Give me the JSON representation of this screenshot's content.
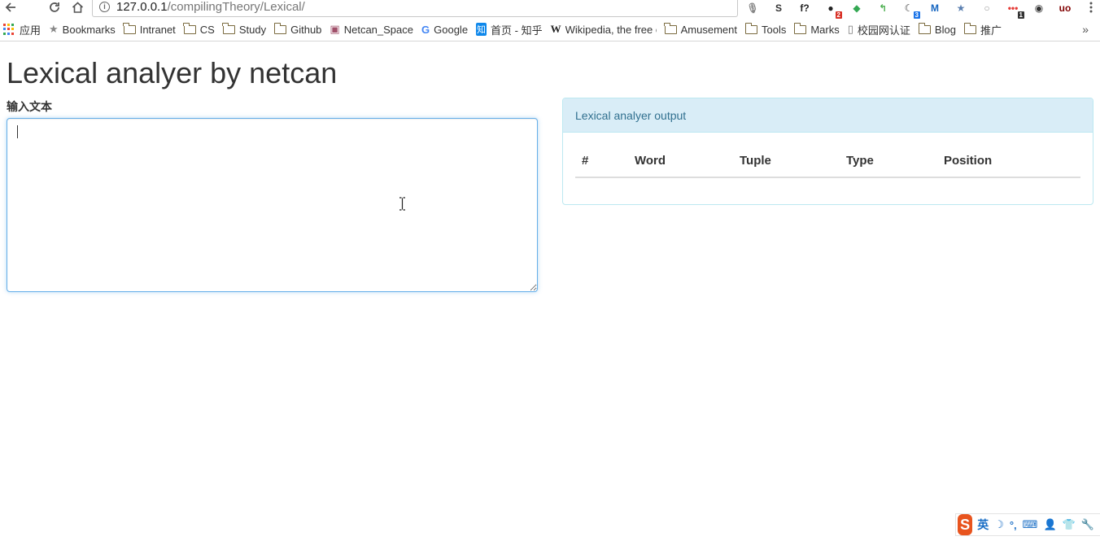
{
  "browser": {
    "url_host": "127.0.0.1",
    "url_path": "/compilingTheory/Lexical/",
    "extensions": [
      {
        "name": "mic-icon",
        "glyph": "🎙",
        "color": "#888888"
      },
      {
        "name": "s-extension-icon",
        "glyph": "S",
        "color": "#333333"
      },
      {
        "name": "f-extension-icon",
        "glyph": "f?",
        "color": "#222222"
      },
      {
        "name": "chat-extension-icon",
        "glyph": "●",
        "color": "#222222",
        "badge": "2",
        "badge_color": "#d93025"
      },
      {
        "name": "colorful-extension-icon",
        "glyph": "◆",
        "color": "#34a853"
      },
      {
        "name": "arrow-extension-icon",
        "glyph": "↰",
        "color": "#4caf50"
      },
      {
        "name": "moon-extension-icon",
        "glyph": "☾",
        "color": "#444444",
        "badge": "3",
        "badge_color": "#1a73e8"
      },
      {
        "name": "m-extension-icon",
        "glyph": "M",
        "color": "#1565c0"
      },
      {
        "name": "star-extension-icon",
        "glyph": "★",
        "color": "#5a7fb0"
      },
      {
        "name": "circle-extension-icon",
        "glyph": "○",
        "color": "#999999"
      },
      {
        "name": "dots-extension-icon",
        "glyph": "•••",
        "color": "#e53935",
        "badge": "1",
        "badge_color": "#333333"
      },
      {
        "name": "camera-extension-icon",
        "glyph": "◉",
        "color": "#333333"
      },
      {
        "name": "ublock-icon",
        "glyph": "uo",
        "color": "#800000"
      }
    ],
    "bookmarks": [
      {
        "label": "应用",
        "icon": "apps-grid-icon"
      },
      {
        "label": "Bookmarks",
        "icon": "star-icon"
      },
      {
        "label": "Intranet",
        "icon": "folder-icon"
      },
      {
        "label": "CS",
        "icon": "folder-icon"
      },
      {
        "label": "Study",
        "icon": "folder-icon"
      },
      {
        "label": "Github",
        "icon": "folder-icon"
      },
      {
        "label": "Netcan_Space",
        "icon": "site-favicon-icon"
      },
      {
        "label": "Google",
        "icon": "google-icon"
      },
      {
        "label": "首页 - 知乎",
        "icon": "zhihu-icon"
      },
      {
        "label": "Wikipedia, the free e",
        "icon": "wikipedia-icon"
      },
      {
        "label": "Amusement",
        "icon": "folder-icon"
      },
      {
        "label": "Tools",
        "icon": "folder-icon"
      },
      {
        "label": "Marks",
        "icon": "folder-icon"
      },
      {
        "label": "校园网认证",
        "icon": "page-icon"
      },
      {
        "label": "Blog",
        "icon": "folder-icon"
      },
      {
        "label": "推广",
        "icon": "folder-icon"
      }
    ],
    "more_bookmarks": "»"
  },
  "page": {
    "title": "Lexical analyer by netcan",
    "input_label": "输入文本",
    "input_value": "",
    "output_panel": {
      "heading": "Lexical analyer output",
      "columns": [
        "#",
        "Word",
        "Tuple",
        "Type",
        "Position"
      ],
      "rows": []
    }
  },
  "ime": {
    "logo": "S",
    "mode": "英",
    "items": [
      "☽",
      "°,",
      "⌨",
      "👤",
      "👕",
      "🔧"
    ]
  },
  "colors": {
    "panel_heading_bg": "#d9edf7",
    "panel_border": "#bce8f1",
    "panel_heading_text": "#31708f",
    "focus_border": "#66afe9",
    "ime_logo": "#e8541e"
  }
}
